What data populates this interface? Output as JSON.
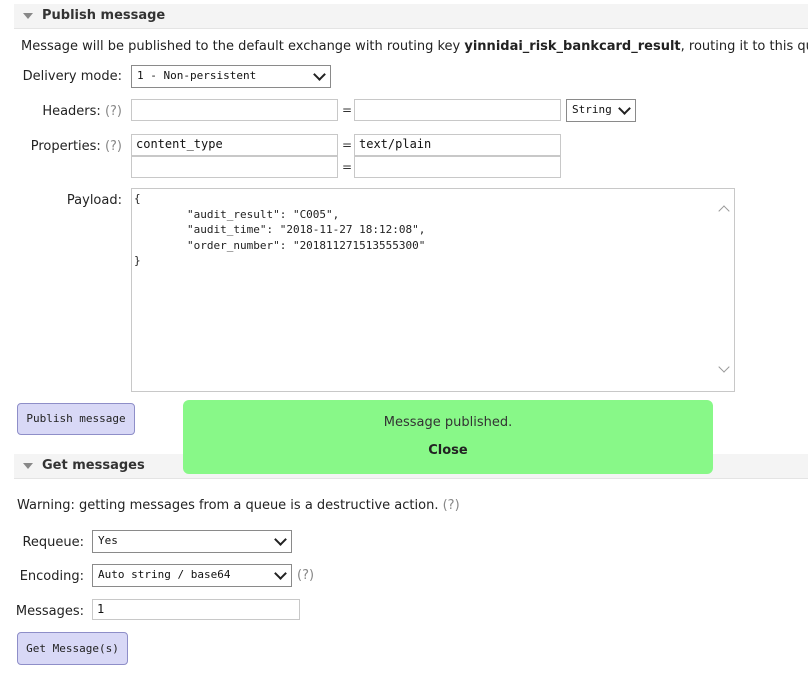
{
  "publish": {
    "title": "Publish message",
    "intro_prefix": "Message will be published to the default exchange with routing key ",
    "routing_key": "yinnidai_risk_bankcard_result",
    "intro_suffix": ", routing it to this queue.",
    "delivery_mode_label": "Delivery mode:",
    "delivery_mode_value": "1 - Non-persistent",
    "headers_label": "Headers:",
    "help": "(?)",
    "headers_key": "",
    "headers_value": "",
    "headers_type": "String",
    "properties_label": "Properties:",
    "properties": [
      {
        "key": "content_type",
        "value": "text/plain"
      },
      {
        "key": "",
        "value": ""
      }
    ],
    "eq": "=",
    "payload_label": "Payload:",
    "payload": "{\n        \"audit_result\": \"C005\",\n        \"audit_time\": \"2018-11-27 18:12:08\",\n        \"order_number\": \"201811271513555300\"\n}",
    "button": "Publish message"
  },
  "toast": {
    "message": "Message published.",
    "close": "Close",
    "color": "#88f888"
  },
  "get": {
    "title": "Get messages",
    "warning": "Warning: getting messages from a queue is a destructive action.",
    "help": "(?)",
    "requeue_label": "Requeue:",
    "requeue_value": "Yes",
    "encoding_label": "Encoding:",
    "encoding_value": "Auto string / base64",
    "messages_label": "Messages:",
    "messages_value": "1",
    "button": "Get Message(s)"
  }
}
